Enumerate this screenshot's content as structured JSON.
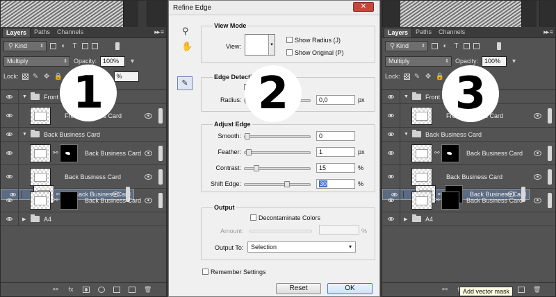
{
  "panels": {
    "tabs": [
      "Layers",
      "Paths",
      "Channels"
    ],
    "tab_menu": "▸▸ ≡",
    "filter_kind": "Kind",
    "blend_mode": "Multiply",
    "opacity_label": "Opacity:",
    "opacity_value": "100%",
    "lock_label": "Lock:",
    "fill_value_partial": "%",
    "layers": [
      {
        "type": "group",
        "name": "Front Business Card",
        "open": true
      },
      {
        "type": "layer",
        "name": "Front Business Card",
        "thumb": "card",
        "mask": null
      },
      {
        "type": "group",
        "name": "Back Business Card",
        "open": true
      },
      {
        "type": "layer",
        "name": "Back Business Card",
        "thumb": "card",
        "mask": "blob"
      },
      {
        "type": "layer",
        "name": "Back Business Card",
        "thumb": "card",
        "mask": null
      },
      {
        "type": "layer",
        "name": "Back Business Card",
        "thumb": "card",
        "mask": null
      },
      {
        "type": "layer",
        "name": "Back Business Card",
        "thumb": "card",
        "mask": "solid"
      },
      {
        "type": "group",
        "name": "A4",
        "open": false
      }
    ],
    "tooltip": "Add vector mask"
  },
  "dialog": {
    "title": "Refine Edge",
    "close_glyph": "✕",
    "view_mode": {
      "heading": "View Mode",
      "view_label": "View:",
      "show_radius": "Show Radius (J)",
      "show_original": "Show Original (P)"
    },
    "edge_detection": {
      "heading": "Edge Detection",
      "smart_radius_partial": "S",
      "radius_label": "Radius:",
      "radius_value": "0,0",
      "radius_unit": "px",
      "radius_pos": 0.0
    },
    "adjust_edge": {
      "heading": "Adjust Edge",
      "rows": [
        {
          "label": "Smooth:",
          "value": "0",
          "unit": "",
          "pos": 0.0,
          "highlight": false
        },
        {
          "label": "Feather:",
          "value": "1",
          "unit": "px",
          "pos": 0.02,
          "highlight": false
        },
        {
          "label": "Contrast:",
          "value": "15",
          "unit": "%",
          "pos": 0.15,
          "highlight": false
        },
        {
          "label": "Shift Edge:",
          "value": "30",
          "unit": "%",
          "pos": 0.65,
          "highlight": true
        }
      ]
    },
    "output": {
      "heading": "Output",
      "decontaminate": "Decontaminate Colors",
      "amount_label": "Amount:",
      "amount_unit": "%",
      "output_to_label": "Output To:",
      "output_to_value": "Selection"
    },
    "remember": "Remember Settings",
    "reset_label": "Reset",
    "ok_label": "OK"
  },
  "steps": [
    "1",
    "2",
    "3"
  ]
}
